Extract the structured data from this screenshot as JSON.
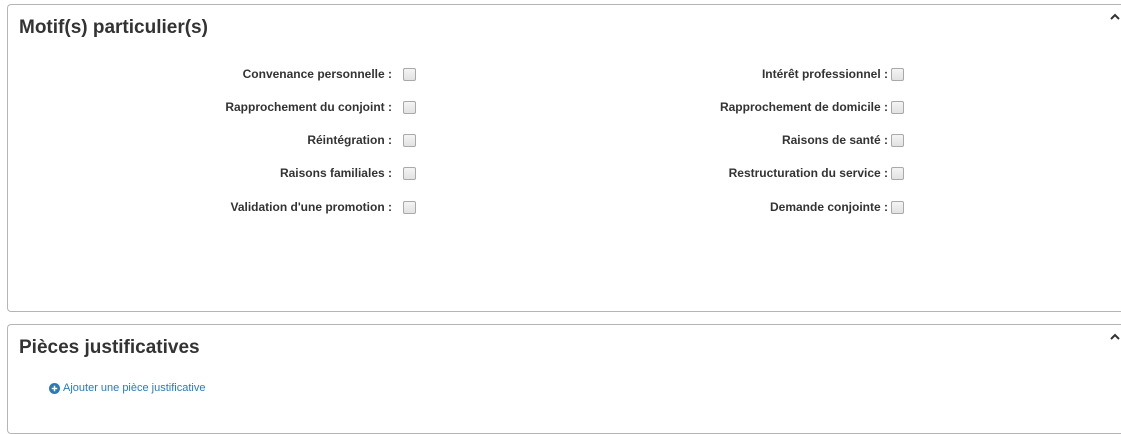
{
  "motifs_panel": {
    "title": "Motif(s) particulier(s)",
    "left_fields": [
      {
        "label": "Convenance personnelle :",
        "checked": false
      },
      {
        "label": "Rapprochement du conjoint :",
        "checked": false
      },
      {
        "label": "Réintégration :",
        "checked": false
      },
      {
        "label": "Raisons familiales :",
        "checked": false
      },
      {
        "label": "Validation d'une promotion :",
        "checked": false
      }
    ],
    "right_fields": [
      {
        "label": "Intérêt professionnel :",
        "checked": false
      },
      {
        "label": "Rapprochement de domicile :",
        "checked": false
      },
      {
        "label": "Raisons de santé :",
        "checked": false
      },
      {
        "label": "Restructuration du service :",
        "checked": false
      },
      {
        "label": "Demande conjointe :",
        "checked": false
      }
    ]
  },
  "pieces_panel": {
    "title": "Pièces justificatives",
    "add_link": "Ajouter une pièce justificative"
  },
  "colors": {
    "link": "#2a7ab8",
    "border": "#b5b5b5",
    "text": "#333333"
  },
  "icons": {
    "collapse": "chevron-up-icon",
    "add": "plus-circle-icon"
  }
}
